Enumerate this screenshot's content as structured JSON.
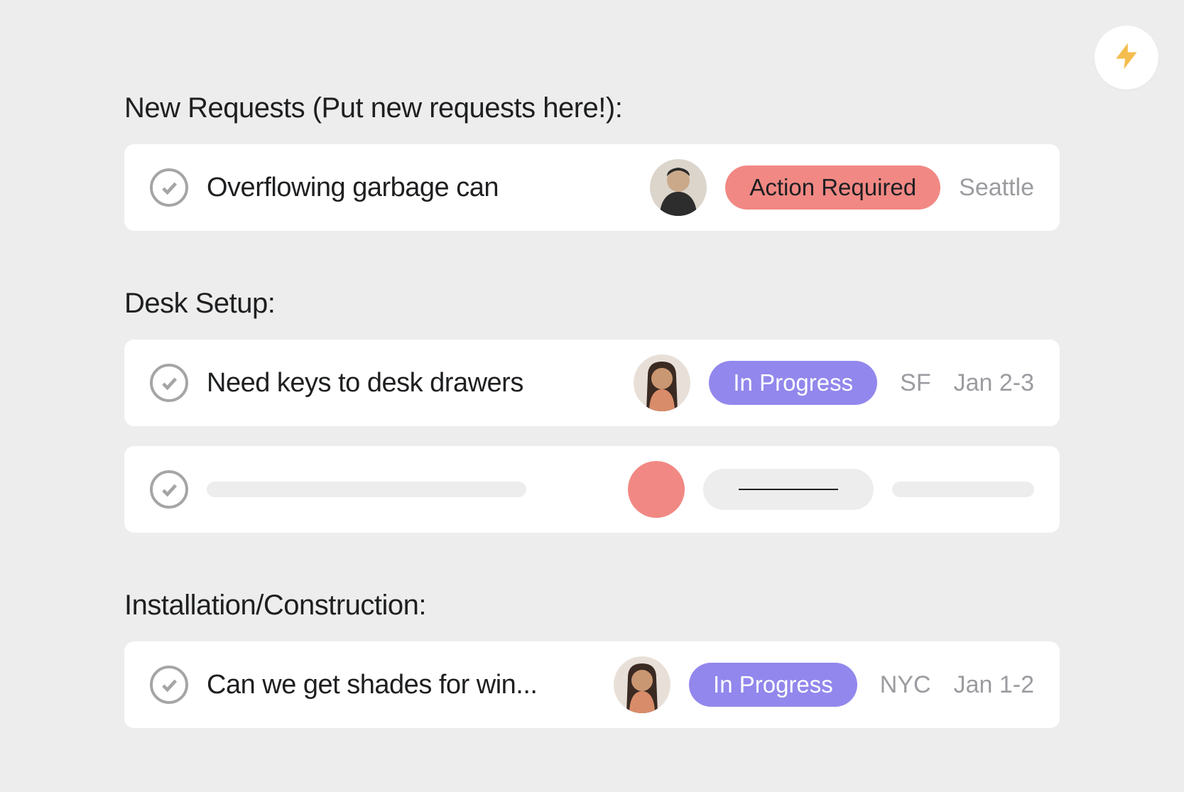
{
  "sections": [
    {
      "title": "New Requests (Put new requests here!):",
      "tasks": [
        {
          "title": "Overflowing garbage can",
          "avatar": "male",
          "status": {
            "label": "Action Required",
            "kind": "action-required"
          },
          "location": "Seattle",
          "date": ""
        }
      ]
    },
    {
      "title": "Desk Setup:",
      "tasks": [
        {
          "title": "Need keys to desk drawers",
          "avatar": "female",
          "status": {
            "label": "In Progress",
            "kind": "in-progress"
          },
          "location": "SF",
          "date": "Jan 2-3"
        },
        {
          "placeholder": true
        }
      ]
    },
    {
      "title": "Installation/Construction:",
      "tasks": [
        {
          "title": "Can we get shades for win...",
          "avatar": "female",
          "status": {
            "label": "In Progress",
            "kind": "in-progress"
          },
          "location": "NYC",
          "date": "Jan 1-2"
        }
      ]
    }
  ]
}
